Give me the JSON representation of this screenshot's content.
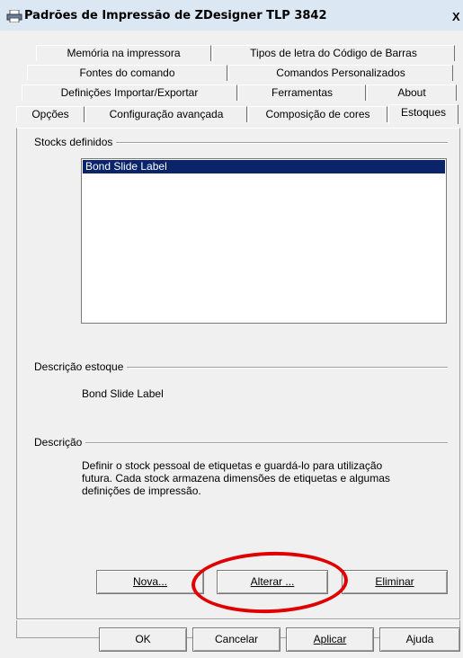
{
  "window": {
    "title": "Padrões de Impressão de ZDesigner TLP 3842",
    "close_glyph": "X"
  },
  "tabs": {
    "row1": [
      "Memória na impressora",
      "Tipos de letra do Código de Barras"
    ],
    "row2": [
      "Fontes do comando",
      "Comandos Personalizados"
    ],
    "row3": [
      "Definições Importar/Exportar",
      "Ferramentas",
      "About"
    ],
    "row4": [
      "Opções",
      "Configuração avançada",
      "Composição de cores",
      "Estoques"
    ],
    "active": "Estoques"
  },
  "stocks": {
    "label": "Stocks definidos",
    "items": [
      "Bond Slide Label"
    ],
    "selected": "Bond Slide Label"
  },
  "stock_description": {
    "label": "Descrição estoque",
    "value": "Bond Slide Label"
  },
  "description": {
    "label": "Descrição",
    "lines": [
      "Definir o stock pessoal de etiquetas e guardá-lo para utilização",
      "futura. Cada stock armazena dimensões de etiquetas e algumas",
      "definições de impressão."
    ]
  },
  "actions": {
    "new": "Nova...",
    "edit": "Alterar ...",
    "delete": "Eliminar"
  },
  "footer": {
    "ok": "OK",
    "cancel": "Cancelar",
    "apply": "Aplicar",
    "help": "Ajuda"
  },
  "colors": {
    "selection": "#0a246a",
    "highlight_circle": "#e00000",
    "dialog_bg": "#f0f0f0"
  }
}
